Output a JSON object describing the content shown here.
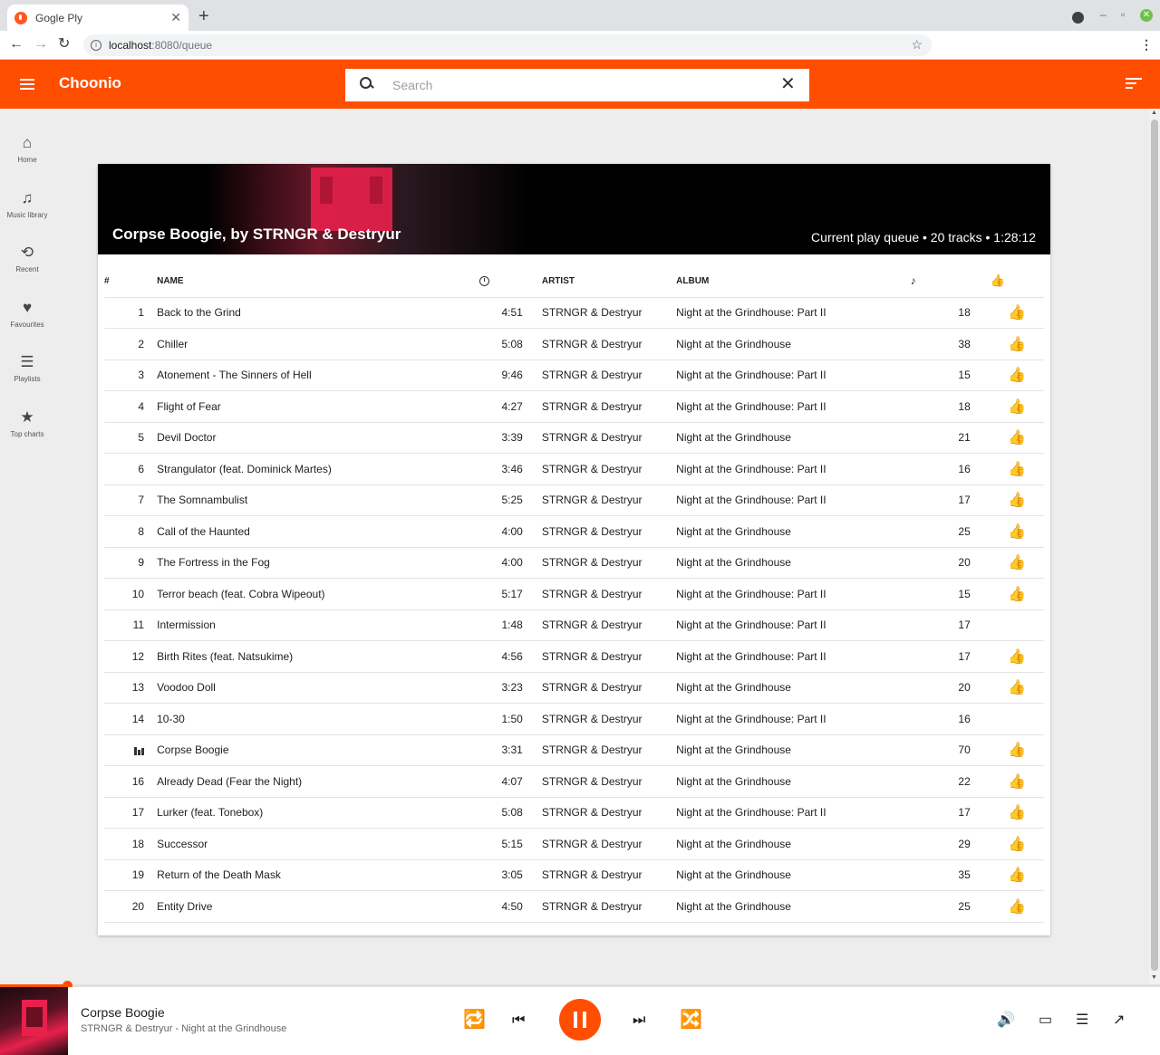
{
  "browser": {
    "tab_title": "Gogle Ply",
    "url_host": "localhost",
    "url_path": ":8080/queue"
  },
  "app": {
    "brand": "Choonio",
    "search_placeholder": "Search",
    "accent": "#ff4e00"
  },
  "sidebar": {
    "items": [
      {
        "label": "Home",
        "icon": "home-icon",
        "glyph": "⌂"
      },
      {
        "label": "Music library",
        "icon": "library-icon",
        "glyph": "♫"
      },
      {
        "label": "Recent",
        "icon": "history-icon",
        "glyph": "⟲"
      },
      {
        "label": "Favourites",
        "icon": "heart-icon",
        "glyph": "♥"
      },
      {
        "label": "Playlists",
        "icon": "list-icon",
        "glyph": "☰"
      },
      {
        "label": "Top charts",
        "icon": "star-icon",
        "glyph": "★"
      }
    ]
  },
  "hero": {
    "title": "Corpse Boogie, by STRNGR & Destryur",
    "meta": "Current play queue • 20 tracks • 1:28:12"
  },
  "table": {
    "headers": {
      "num": "#",
      "name": "NAME",
      "artist": "ARTIST",
      "album": "ALBUM"
    },
    "rows": [
      {
        "num": "1",
        "name": "Back to the Grind",
        "duration": "4:51",
        "artist": "STRNGR & Destryur",
        "album": "Night at the Grindhouse: Part II",
        "plays": "18",
        "liked": true
      },
      {
        "num": "2",
        "name": "Chiller",
        "duration": "5:08",
        "artist": "STRNGR & Destryur",
        "album": "Night at the Grindhouse",
        "plays": "38",
        "liked": true
      },
      {
        "num": "3",
        "name": "Atonement - The Sinners of Hell",
        "duration": "9:46",
        "artist": "STRNGR & Destryur",
        "album": "Night at the Grindhouse: Part II",
        "plays": "15",
        "liked": true
      },
      {
        "num": "4",
        "name": "Flight of Fear",
        "duration": "4:27",
        "artist": "STRNGR & Destryur",
        "album": "Night at the Grindhouse: Part II",
        "plays": "18",
        "liked": true
      },
      {
        "num": "5",
        "name": "Devil Doctor",
        "duration": "3:39",
        "artist": "STRNGR & Destryur",
        "album": "Night at the Grindhouse",
        "plays": "21",
        "liked": true
      },
      {
        "num": "6",
        "name": "Strangulator (feat. Dominick Martes)",
        "duration": "3:46",
        "artist": "STRNGR & Destryur",
        "album": "Night at the Grindhouse: Part II",
        "plays": "16",
        "liked": true
      },
      {
        "num": "7",
        "name": "The Somnambulist",
        "duration": "5:25",
        "artist": "STRNGR & Destryur",
        "album": "Night at the Grindhouse: Part II",
        "plays": "17",
        "liked": true
      },
      {
        "num": "8",
        "name": "Call of the Haunted",
        "duration": "4:00",
        "artist": "STRNGR & Destryur",
        "album": "Night at the Grindhouse",
        "plays": "25",
        "liked": true
      },
      {
        "num": "9",
        "name": "The Fortress in the Fog",
        "duration": "4:00",
        "artist": "STRNGR & Destryur",
        "album": "Night at the Grindhouse",
        "plays": "20",
        "liked": true
      },
      {
        "num": "10",
        "name": "Terror beach (feat. Cobra Wipeout)",
        "duration": "5:17",
        "artist": "STRNGR & Destryur",
        "album": "Night at the Grindhouse: Part II",
        "plays": "15",
        "liked": true
      },
      {
        "num": "11",
        "name": "Intermission",
        "duration": "1:48",
        "artist": "STRNGR & Destryur",
        "album": "Night at the Grindhouse: Part II",
        "plays": "17",
        "liked": false
      },
      {
        "num": "12",
        "name": "Birth Rites (feat. Natsukime)",
        "duration": "4:56",
        "artist": "STRNGR & Destryur",
        "album": "Night at the Grindhouse: Part II",
        "plays": "17",
        "liked": true
      },
      {
        "num": "13",
        "name": "Voodoo Doll",
        "duration": "3:23",
        "artist": "STRNGR & Destryur",
        "album": "Night at the Grindhouse",
        "plays": "20",
        "liked": true
      },
      {
        "num": "14",
        "name": "10-30",
        "duration": "1:50",
        "artist": "STRNGR & Destryur",
        "album": "Night at the Grindhouse: Part II",
        "plays": "16",
        "liked": false
      },
      {
        "num": "",
        "playing": true,
        "name": "Corpse Boogie",
        "duration": "3:31",
        "artist": "STRNGR & Destryur",
        "album": "Night at the Grindhouse",
        "plays": "70",
        "liked": true
      },
      {
        "num": "16",
        "name": "Already Dead (Fear the Night)",
        "duration": "4:07",
        "artist": "STRNGR & Destryur",
        "album": "Night at the Grindhouse",
        "plays": "22",
        "liked": true
      },
      {
        "num": "17",
        "name": "Lurker (feat. Tonebox)",
        "duration": "5:08",
        "artist": "STRNGR & Destryur",
        "album": "Night at the Grindhouse: Part II",
        "plays": "17",
        "liked": true
      },
      {
        "num": "18",
        "name": "Successor",
        "duration": "5:15",
        "artist": "STRNGR & Destryur",
        "album": "Night at the Grindhouse",
        "plays": "29",
        "liked": true
      },
      {
        "num": "19",
        "name": "Return of the Death Mask",
        "duration": "3:05",
        "artist": "STRNGR & Destryur",
        "album": "Night at the Grindhouse",
        "plays": "35",
        "liked": true
      },
      {
        "num": "20",
        "name": "Entity Drive",
        "duration": "4:50",
        "artist": "STRNGR & Destryur",
        "album": "Night at the Grindhouse",
        "plays": "25",
        "liked": true
      }
    ]
  },
  "player": {
    "title": "Corpse Boogie",
    "subtitle": "STRNGR & Destryur - Night at the Grindhouse",
    "progress": 0.058
  }
}
